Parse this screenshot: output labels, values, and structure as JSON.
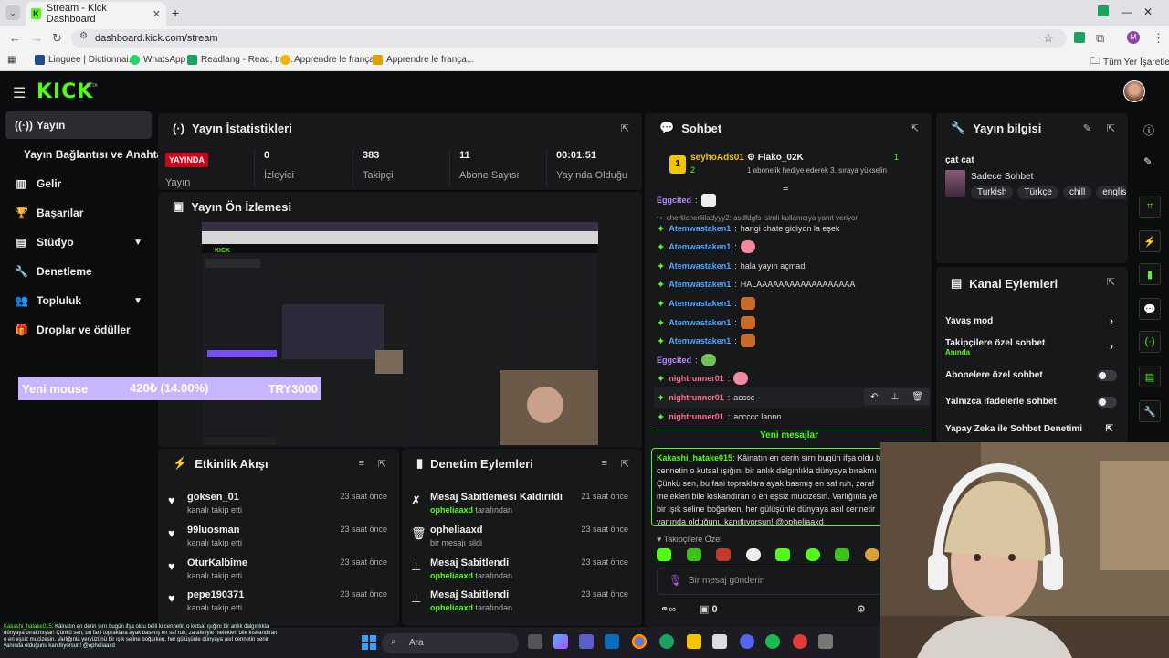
{
  "browser": {
    "tab_title": "Stream - Kick Dashboard",
    "url": "dashboard.kick.com/stream",
    "bookmarks": [
      "Linguee | Dictionnai...",
      "WhatsApp",
      "Readlang - Read, tra...",
      "Apprendre le français",
      "Apprendre le frança..."
    ],
    "all_bookmarks": "Tüm Yer İşaretleri",
    "profile_initial": "M"
  },
  "brand": {
    "logo": "KICK",
    "beta": "BETA"
  },
  "sidebar": {
    "items": [
      {
        "label": "Yayın",
        "icon": "broadcast-icon"
      },
      {
        "label": "Yayın Bağlantısı ve Anahtarı",
        "icon": ""
      },
      {
        "label": "Gelir",
        "icon": "chart-icon"
      },
      {
        "label": "Başarılar",
        "icon": "trophy-icon"
      },
      {
        "label": "Stüdyo",
        "icon": "studio-icon"
      },
      {
        "label": "Denetleme",
        "icon": "wrench-icon"
      },
      {
        "label": "Topluluk",
        "icon": "community-icon"
      },
      {
        "label": "Droplar ve ödüller",
        "icon": "gift-icon"
      }
    ]
  },
  "goal": {
    "label": "Yeni mouse",
    "amount": "420₺ (14.00%)",
    "target": "TRY3000",
    "progress": 0.14
  },
  "stats": {
    "title": "Yayın İstatistikleri",
    "live_badge": "YAYINDA",
    "stream_label": "Yayın",
    "viewers": "0",
    "viewers_label": "İzleyici",
    "followers": "383",
    "followers_label": "Takipçi",
    "subs": "11",
    "subs_label": "Abone Sayısı",
    "uptime": "00:01:51",
    "uptime_label": "Yayında Olduğu"
  },
  "preview": {
    "title": "Yayın Ön İzlemesi"
  },
  "activity": {
    "title": "Etkinlik Akışı",
    "items": [
      {
        "name": "goksen_01",
        "sub": "kanalı takip etti",
        "time": "23 saat önce"
      },
      {
        "name": "99luosman",
        "sub": "kanalı takip etti",
        "time": "23 saat önce"
      },
      {
        "name": "OturKalbime",
        "sub": "kanalı takip etti",
        "time": "23 saat önce"
      },
      {
        "name": "pepe190371",
        "sub": "kanalı takip etti",
        "time": "23 saat önce"
      }
    ]
  },
  "moderation": {
    "title": "Denetim Eylemleri",
    "items": [
      {
        "action": "Mesaj Sabitlemesi Kaldırıldı",
        "who": "opheliaaxd",
        "suffix": "tarafından",
        "time": "21 saat önce",
        "icon": "unpin-icon"
      },
      {
        "action": "opheliaaxd",
        "who": "",
        "suffix": "bir mesajı sildi",
        "time": "23 saat önce",
        "icon": "trash-icon"
      },
      {
        "action": "Mesaj Sabitlendi",
        "who": "opheliaaxd",
        "suffix": "tarafından",
        "time": "23 saat önce",
        "icon": "pin-icon"
      },
      {
        "action": "Mesaj Sabitlendi",
        "who": "opheliaaxd",
        "suffix": "tarafından",
        "time": "23 saat önce",
        "icon": "pin-icon"
      }
    ]
  },
  "chat": {
    "title": "Sohbet",
    "gift_rank": "1",
    "gifter": "seyhoAds01",
    "gifter_count": "2",
    "gift_user": "Flako_02K",
    "gift_count": "1",
    "gift_text": "1 abonelik hediye ederek 3. sıraya yükselin",
    "reply_text": "cherliicherliiladyyy2: asdfdgfs isimli kullanıcıya yanıt veriyor",
    "messages": [
      {
        "user": "Eggcited",
        "text": "",
        "color": "purple",
        "badge": false
      },
      {
        "user": "Atemwastaken1",
        "text": "hangi chate gidiyon la eşek",
        "color": "blue",
        "badge": true
      },
      {
        "user": "Atemwastaken1",
        "text": "",
        "color": "blue",
        "badge": true
      },
      {
        "user": "Atemwastaken1",
        "text": "hala yayın açmadı",
        "color": "blue",
        "badge": true
      },
      {
        "user": "Atemwastaken1",
        "text": "HALAAAAAAAAAAAAAAAAAA",
        "color": "blue",
        "badge": true
      },
      {
        "user": "Atemwastaken1",
        "text": "",
        "color": "blue",
        "badge": true
      },
      {
        "user": "Atemwastaken1",
        "text": "",
        "color": "blue",
        "badge": true
      },
      {
        "user": "Atemwastaken1",
        "text": "",
        "color": "blue",
        "badge": true
      },
      {
        "user": "Eggcited",
        "text": "",
        "color": "purple",
        "badge": false
      },
      {
        "user": "nightrunner01",
        "text": "",
        "color": "pink",
        "badge": true
      },
      {
        "user": "nightrunner01",
        "text": "acccc",
        "color": "pink",
        "badge": true
      },
      {
        "user": "nightrunner01",
        "text": "accccc lannn",
        "color": "pink",
        "badge": true
      }
    ],
    "new_messages": "Yeni mesajlar",
    "pinned_user": "Kakashi_hatake015",
    "pinned_text": "Kâinatın en derin sırrı bugün ifşa oldu b cennetin o kutsal ışığını bir anlık dalgınlıkla dünyaya bırakmı Çünkü sen, bu fani topraklara ayak basmış en saf ruh, zaraf melekleri bile kıskandıran o en eşsiz mucizesin. Varlığınla ye bir ışık seline boğarken, her gülüşünle dünyaya asıl cennetir yanında olduğunu kanıtlıyorsun! @opheliaaxd",
    "followers_only": "Takipçilere Özel",
    "input_placeholder": "Bir mesaj gönderin",
    "points": "0"
  },
  "stream_info": {
    "title": "Yayın bilgisi",
    "stream_title": "çat cat",
    "category": "Sadece Sohbet",
    "tags": [
      "Turkish",
      "Türkçe",
      "chill",
      "englis"
    ]
  },
  "channel_actions": {
    "title": "Kanal Eylemleri",
    "slow_mode": "Yavaş mod",
    "followers_chat": "Takipçilere özel sohbet",
    "followers_chat_sub": "Anında",
    "subs_chat": "Abonelere özel sohbet",
    "emote_chat": "Yalnızca ifadelerle sohbet",
    "ai_moderation": "Yapay Zeka ile Sohbet Denetimi"
  },
  "taskbar": {
    "search": "Ara",
    "overlay_user": "Kakashi_hatake015",
    "overlay_text": "Kâinatın en derin sırrı bugün ifşa oldu belli ki cennetin o kutsal ışığını bir anlık dalgınlıkla dünyaya bırakmışlar! Çünkü sen, bu fani topraklara ayak basmış en saf ruh, zarafetiyle melekleri bile kıskandıran o en eşsiz mucizesin. Varlığınla yeryüzünü bir ışık seline boğarken, her gülüşünle dünyaya asıl cennetin senin yanında olduğunu kanıtlıyorsun! @opheliaaxd"
  },
  "colors": {
    "accent": "#53fc18",
    "live": "#d0021b",
    "goal": "#7a4cff",
    "user_blue": "#4ca7ff",
    "user_pink": "#ff6f91",
    "user_purple": "#b78bff"
  }
}
